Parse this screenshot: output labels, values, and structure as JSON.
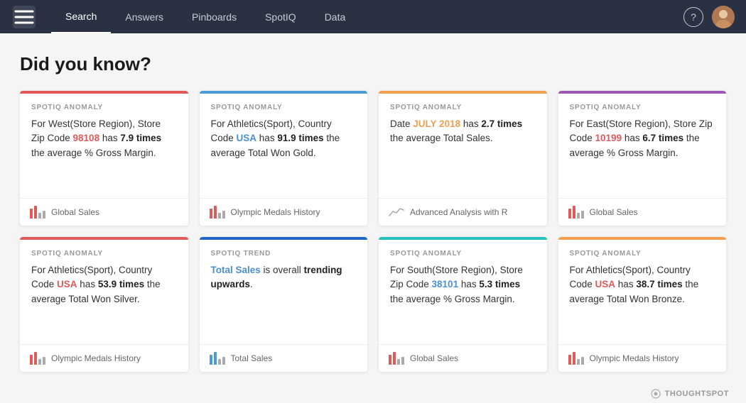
{
  "nav": {
    "links": [
      {
        "label": "Search",
        "active": true
      },
      {
        "label": "Answers",
        "active": false
      },
      {
        "label": "Pinboards",
        "active": false
      },
      {
        "label": "SpotIQ",
        "active": false
      },
      {
        "label": "Data",
        "active": false
      }
    ],
    "help_label": "?",
    "brand_footer": "THOUGHTSPOT"
  },
  "page": {
    "title": "Did you know?"
  },
  "cards": [
    {
      "border_color": "#e05a5a",
      "label": "SPOTIQ ANOMALY",
      "text_parts": [
        {
          "type": "plain",
          "text": "For West(Store Region), Store Zip Code "
        },
        {
          "type": "highlight-red",
          "text": "98108"
        },
        {
          "type": "plain",
          "text": " has "
        },
        {
          "type": "strong",
          "text": "7.9 times"
        },
        {
          "type": "plain",
          "text": " the average % Gross Margin."
        }
      ],
      "footer_icon": "bar-chart",
      "footer_bar_colors": [
        "#e05a5a",
        "#e05a5a",
        "#aaa",
        "#aaa"
      ],
      "footer_bar_heights": [
        14,
        18,
        8,
        11
      ],
      "footer_text": "Global Sales"
    },
    {
      "border_color": "#4a9bd4",
      "label": "SPOTIQ ANOMALY",
      "text_parts": [
        {
          "type": "plain",
          "text": "For Athletics(Sport), Country Code "
        },
        {
          "type": "highlight-blue",
          "text": "USA"
        },
        {
          "type": "plain",
          "text": " has "
        },
        {
          "type": "strong",
          "text": "91.9 times"
        },
        {
          "type": "plain",
          "text": " the average Total Won Gold."
        }
      ],
      "footer_icon": "bar-chart",
      "footer_bar_colors": [
        "#e05a5a",
        "#e05a5a",
        "#aaa",
        "#aaa"
      ],
      "footer_bar_heights": [
        14,
        18,
        8,
        11
      ],
      "footer_text": "Olympic Medals History"
    },
    {
      "border_color": "#f0a050",
      "label": "SPOTIQ ANOMALY",
      "text_parts": [
        {
          "type": "plain",
          "text": "Date "
        },
        {
          "type": "highlight-orange",
          "text": "JULY 2018"
        },
        {
          "type": "plain",
          "text": " has "
        },
        {
          "type": "strong",
          "text": "2.7 times"
        },
        {
          "type": "plain",
          "text": " the average Total Sales."
        }
      ],
      "footer_icon": "line-chart",
      "footer_text": "Advanced Analysis with R"
    },
    {
      "border_color": "#9b59b6",
      "label": "SPOTIQ ANOMALY",
      "text_parts": [
        {
          "type": "plain",
          "text": "For East(Store Region), Store Zip Code "
        },
        {
          "type": "highlight-red",
          "text": "10199"
        },
        {
          "type": "plain",
          "text": " has "
        },
        {
          "type": "strong",
          "text": "6.7 times"
        },
        {
          "type": "plain",
          "text": " the average % Gross Margin."
        }
      ],
      "footer_icon": "bar-chart",
      "footer_bar_colors": [
        "#e05a5a",
        "#e05a5a",
        "#aaa",
        "#aaa"
      ],
      "footer_bar_heights": [
        14,
        18,
        8,
        11
      ],
      "footer_text": "Global Sales"
    },
    {
      "border_color": "#e05a5a",
      "label": "SPOTIQ ANOMALY",
      "text_parts": [
        {
          "type": "plain",
          "text": "For Athletics(Sport), Country Code "
        },
        {
          "type": "highlight-red",
          "text": "USA"
        },
        {
          "type": "plain",
          "text": " has "
        },
        {
          "type": "strong",
          "text": "53.9 times"
        },
        {
          "type": "plain",
          "text": " the average Total Won Silver."
        }
      ],
      "footer_icon": "bar-chart",
      "footer_bar_colors": [
        "#e05a5a",
        "#e05a5a",
        "#aaa",
        "#aaa"
      ],
      "footer_bar_heights": [
        14,
        18,
        8,
        11
      ],
      "footer_text": "Olympic Medals History"
    },
    {
      "border_color": "#2266cc",
      "label": "SPOTIQ TREND",
      "text_parts": [
        {
          "type": "highlight-blue",
          "text": "Total Sales"
        },
        {
          "type": "plain",
          "text": " is overall "
        },
        {
          "type": "strong",
          "text": "trending upwards"
        },
        {
          "type": "plain",
          "text": "."
        }
      ],
      "footer_icon": "bar-chart",
      "footer_bar_colors": [
        "#4a9bd4",
        "#4a9bd4",
        "#aaa",
        "#aaa"
      ],
      "footer_bar_heights": [
        14,
        18,
        8,
        11
      ],
      "footer_text": "Total Sales"
    },
    {
      "border_color": "#26c0c0",
      "label": "SPOTIQ ANOMALY",
      "text_parts": [
        {
          "type": "plain",
          "text": "For South(Store Region), Store Zip Code "
        },
        {
          "type": "highlight-blue",
          "text": "38101"
        },
        {
          "type": "plain",
          "text": " has "
        },
        {
          "type": "strong",
          "text": "5.3 times"
        },
        {
          "type": "plain",
          "text": " the average % Gross Margin."
        }
      ],
      "footer_icon": "bar-chart",
      "footer_bar_colors": [
        "#e05a5a",
        "#e05a5a",
        "#aaa",
        "#aaa"
      ],
      "footer_bar_heights": [
        14,
        18,
        8,
        11
      ],
      "footer_text": "Global Sales"
    },
    {
      "border_color": "#f0a050",
      "label": "SPOTIQ ANOMALY",
      "text_parts": [
        {
          "type": "plain",
          "text": "For Athletics(Sport), Country Code "
        },
        {
          "type": "highlight-red",
          "text": "USA"
        },
        {
          "type": "plain",
          "text": " has "
        },
        {
          "type": "strong",
          "text": "38.7 times"
        },
        {
          "type": "plain",
          "text": " the average Total Won Bronze."
        }
      ],
      "footer_icon": "bar-chart",
      "footer_bar_colors": [
        "#e05a5a",
        "#e05a5a",
        "#aaa",
        "#aaa"
      ],
      "footer_bar_heights": [
        14,
        18,
        8,
        11
      ],
      "footer_text": "Olympic Medals History"
    }
  ]
}
